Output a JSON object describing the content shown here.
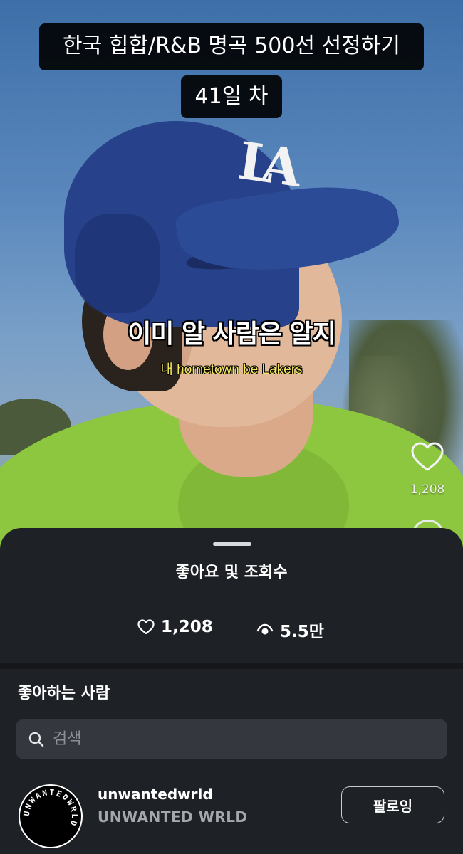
{
  "video": {
    "title_line1": "한국 힙합/R&B 명곡 500선 선정하기",
    "title_line2": "41일 차",
    "lyric_main": "이미 알 사람은 알지",
    "lyric_sub": "내 hometown be Lakers",
    "cap_logo": "LA",
    "side_like_count": "1,208"
  },
  "sheet": {
    "title": "좋아요 및 조회수",
    "likes_count": "1,208",
    "views_count": "5.5만",
    "likers_title": "좋아하는 사람",
    "search_placeholder": "검색"
  },
  "users": [
    {
      "username": "unwantedwrld",
      "display_name": "UNWANTED WRLD",
      "avatar_text": "UNWANTEDWRLD",
      "follow_label": "팔로잉"
    }
  ],
  "icons": {
    "side_like": "heart-outline-icon",
    "likes": "heart-outline-icon",
    "views": "eye-icon",
    "search": "search-icon"
  },
  "colors": {
    "sheet_bg": "#1e2126",
    "search_bg": "#34373d",
    "lyric_sub": "#f3e95a",
    "secondary_text": "#a4a7ad"
  }
}
